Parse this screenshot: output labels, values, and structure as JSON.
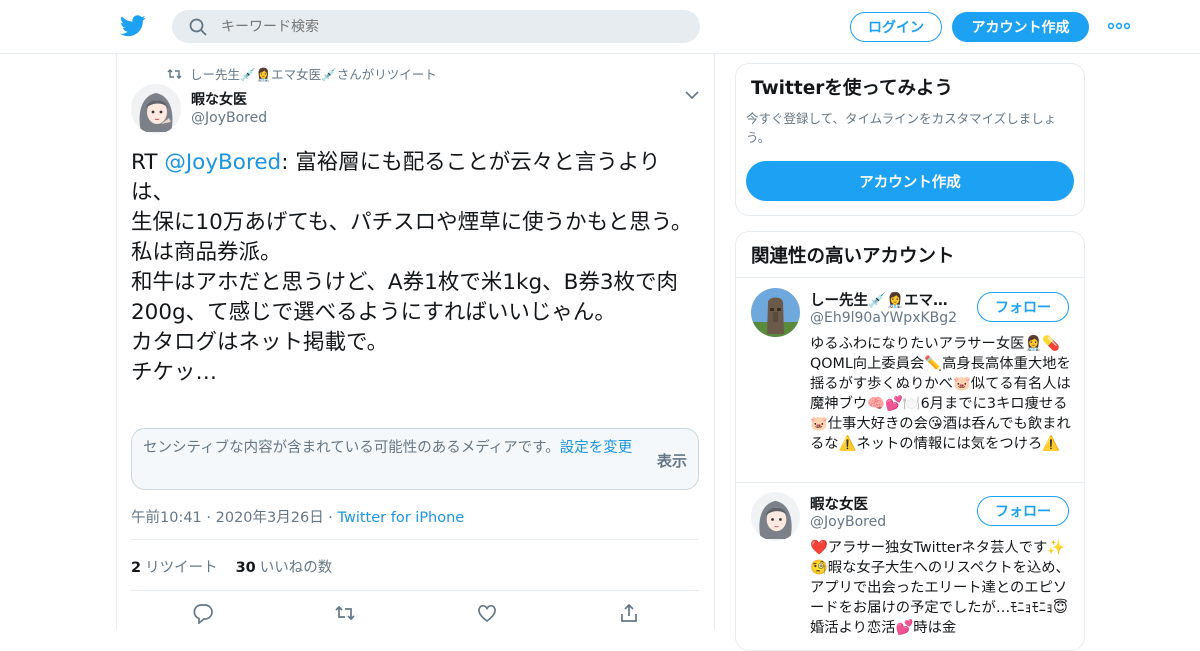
{
  "colors": {
    "accent": "#1da1f2",
    "link": "#1b95e0",
    "muted": "#657786",
    "text": "#14171a",
    "border": "#e6ecf0"
  },
  "header": {
    "logo_icon": "twitter-bird-icon",
    "search": {
      "placeholder": "キーワード検索",
      "icon": "search-icon"
    },
    "login_label": "ログイン",
    "signup_label": "アカウント作成",
    "more_icon": "more-dots-icon"
  },
  "tweet": {
    "retweet_context": "しー先生💉👩‍⚕️エマ女医💉さんがリツイート",
    "author": {
      "name": "暇な女医",
      "handle": "@JoyBored"
    },
    "text_prefix": "RT ",
    "mention": "@JoyBored",
    "text_body": ": 富裕層にも配ることが云々と言うよりは、\n生保に10万あげても、パチスロや煙草に使うかもと思う。\n私は商品券派。\n和牛はアホだと思うけど、A券1枚で米1kg、B券3枚で肉200g、て感じで選べるようにすればいいじゃん。\nカタログはネット掲載で。\nチケッ…",
    "sensitive": {
      "message": "センシティブな内容が含まれている可能性のあるメディアです。",
      "settings_link": "設定を変更",
      "show_label": "表示"
    },
    "timestamp": "午前10:41 · 2020年3月26日",
    "separator": " · ",
    "client": "Twitter for iPhone",
    "retweets": {
      "count": "2",
      "label": "リツイート"
    },
    "likes": {
      "count": "30",
      "label": "いいねの数"
    }
  },
  "sidebar": {
    "signup_card": {
      "title": "Twitterを使ってみよう",
      "subtitle": "今すぐ登録して、タイムラインをカスタマイズしましょう。",
      "cta": "アカウント作成"
    },
    "related": {
      "title": "関連性の高いアカウント",
      "follow_label": "フォロー",
      "accounts": [
        {
          "name": "しー先生💉👩‍⚕️エマ…",
          "handle": "@Eh9l90aYWpxKBg2",
          "bio": "ゆるふわになりたいアラサー女医👩‍⚕️💊QOML向上委員会✏️高身長高体重大地を揺るがす歩くぬりかべ🐷似てる有名人は魔神ブウ🧠💕🍽️6月までに3キロ痩せる🐷仕事大好きの会😘酒は呑んでも飲まれるな⚠️ネットの情報には気をつけろ⚠️"
        },
        {
          "name": "暇な女医",
          "handle": "@JoyBored",
          "bio": "❤️アラサー独女Twitterネタ芸人です✨🧐暇な女子大生へのリスペクトを込め、アプリで出会ったエリート達とのエピソードをお届けの予定でしたが…ﾓﾆｮﾓﾆｮ😇婚活より恋活💕時は金"
        }
      ]
    }
  }
}
